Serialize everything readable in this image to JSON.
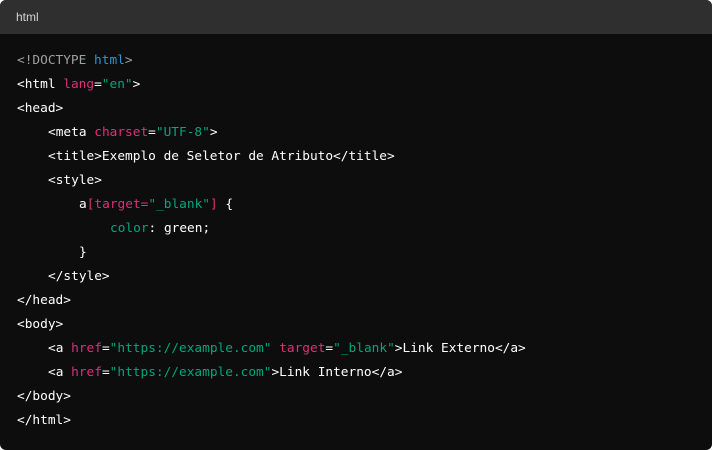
{
  "header": {
    "language_label": "html"
  },
  "colors": {
    "background": "#0d0d0d",
    "header_background": "#2f2f2f",
    "plain": "#ffffff",
    "doctype": "#a0a0a0",
    "keyword": "#2e95d3",
    "attribute": "#df3079",
    "string": "#00a67d",
    "property": "#00a67d"
  },
  "lines": [
    {
      "indent": 0,
      "tokens": [
        {
          "t": "<!DOCTYPE ",
          "c": "doctype"
        },
        {
          "t": "html",
          "c": "keyword"
        },
        {
          "t": ">",
          "c": "doctype"
        }
      ]
    },
    {
      "indent": 0,
      "tokens": [
        {
          "t": "<html ",
          "c": "plain"
        },
        {
          "t": "lang",
          "c": "attribute"
        },
        {
          "t": "=",
          "c": "plain"
        },
        {
          "t": "\"en\"",
          "c": "string"
        },
        {
          "t": ">",
          "c": "plain"
        }
      ]
    },
    {
      "indent": 0,
      "tokens": [
        {
          "t": "<head>",
          "c": "plain"
        }
      ]
    },
    {
      "indent": 1,
      "tokens": [
        {
          "t": "<meta ",
          "c": "plain"
        },
        {
          "t": "charset",
          "c": "attribute"
        },
        {
          "t": "=",
          "c": "plain"
        },
        {
          "t": "\"UTF-8\"",
          "c": "string"
        },
        {
          "t": ">",
          "c": "plain"
        }
      ]
    },
    {
      "indent": 1,
      "tokens": [
        {
          "t": "<title>Exemplo de Seletor de Atributo</title>",
          "c": "plain"
        }
      ]
    },
    {
      "indent": 1,
      "tokens": [
        {
          "t": "<style>",
          "c": "plain"
        }
      ]
    },
    {
      "indent": 2,
      "tokens": [
        {
          "t": "a",
          "c": "plain"
        },
        {
          "t": "[target=",
          "c": "attribute"
        },
        {
          "t": "\"_blank\"",
          "c": "string"
        },
        {
          "t": "]",
          "c": "attribute"
        },
        {
          "t": " {",
          "c": "plain"
        }
      ]
    },
    {
      "indent": 3,
      "tokens": [
        {
          "t": "color",
          "c": "property"
        },
        {
          "t": ": green;",
          "c": "plain"
        }
      ]
    },
    {
      "indent": 2,
      "tokens": [
        {
          "t": "}",
          "c": "plain"
        }
      ]
    },
    {
      "indent": 1,
      "tokens": [
        {
          "t": "</style>",
          "c": "plain"
        }
      ]
    },
    {
      "indent": 0,
      "tokens": [
        {
          "t": "</head>",
          "c": "plain"
        }
      ]
    },
    {
      "indent": 0,
      "tokens": [
        {
          "t": "<body>",
          "c": "plain"
        }
      ]
    },
    {
      "indent": 1,
      "tokens": [
        {
          "t": "<a ",
          "c": "plain"
        },
        {
          "t": "href",
          "c": "attribute"
        },
        {
          "t": "=",
          "c": "plain"
        },
        {
          "t": "\"https://example.com\"",
          "c": "string"
        },
        {
          "t": " ",
          "c": "plain"
        },
        {
          "t": "target",
          "c": "attribute"
        },
        {
          "t": "=",
          "c": "plain"
        },
        {
          "t": "\"_blank\"",
          "c": "string"
        },
        {
          "t": ">Link Externo</a>",
          "c": "plain"
        }
      ]
    },
    {
      "indent": 1,
      "tokens": [
        {
          "t": "<a ",
          "c": "plain"
        },
        {
          "t": "href",
          "c": "attribute"
        },
        {
          "t": "=",
          "c": "plain"
        },
        {
          "t": "\"https://example.com\"",
          "c": "string"
        },
        {
          "t": ">Link Interno</a>",
          "c": "plain"
        }
      ]
    },
    {
      "indent": 0,
      "tokens": [
        {
          "t": "</body>",
          "c": "plain"
        }
      ]
    },
    {
      "indent": 0,
      "tokens": [
        {
          "t": "</html>",
          "c": "plain"
        }
      ]
    }
  ]
}
